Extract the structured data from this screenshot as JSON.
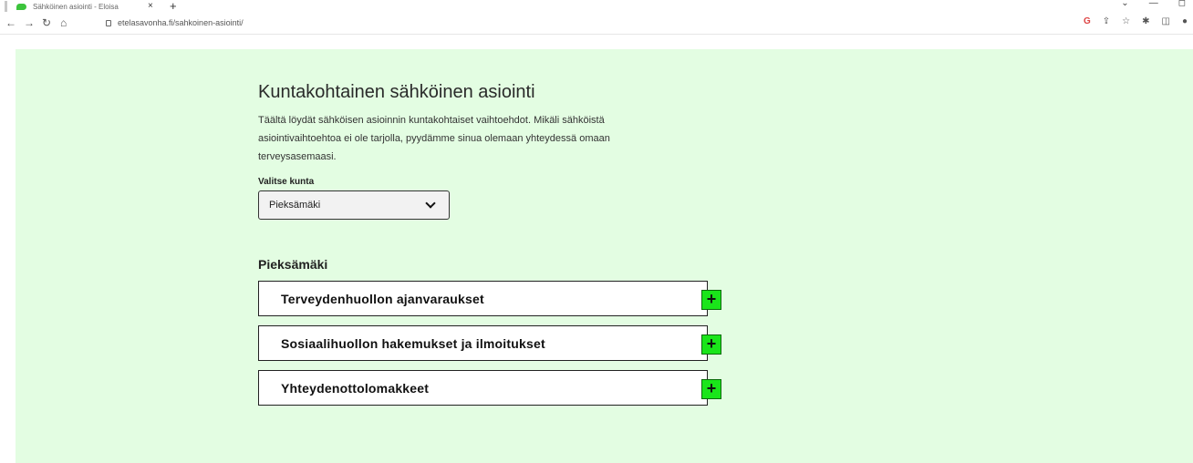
{
  "browser": {
    "tab_title": "Sähköinen asiointi - Eloisa",
    "tab_close": "×",
    "tab_new": "+",
    "url": "etelasavonha.fi/sahkoinen-asiointi/",
    "window_controls": [
      "⌄",
      "—",
      "◻"
    ],
    "ext_icons": [
      "G",
      "⇪",
      "☆",
      "✱",
      "◫",
      "●"
    ]
  },
  "page": {
    "heading": "Kuntakohtainen sähköinen asiointi",
    "intro": "Täältä löydät sähköisen asioinnin kuntakohtaiset vaihtoehdot. Mikäli sähköistä asiointivaihtoehtoa ei ole tarjolla, pyydämme sinua olemaan yhteydessä omaan terveysasemaasi.",
    "select_label": "Valitse kunta",
    "selected_municipality": "Pieksämäki",
    "section_title": "Pieksämäki",
    "accordion": [
      {
        "label": "Terveydenhuollon ajanvaraukset"
      },
      {
        "label": "Sosiaalihuollon hakemukset ja ilmoitukset"
      },
      {
        "label": "Yhteydenottolomakkeet"
      }
    ],
    "expand_symbol": "+"
  },
  "colors": {
    "page_background": "#e3fde2",
    "accent_green": "#1ae51a",
    "favicon_green": "#3cc43c"
  }
}
